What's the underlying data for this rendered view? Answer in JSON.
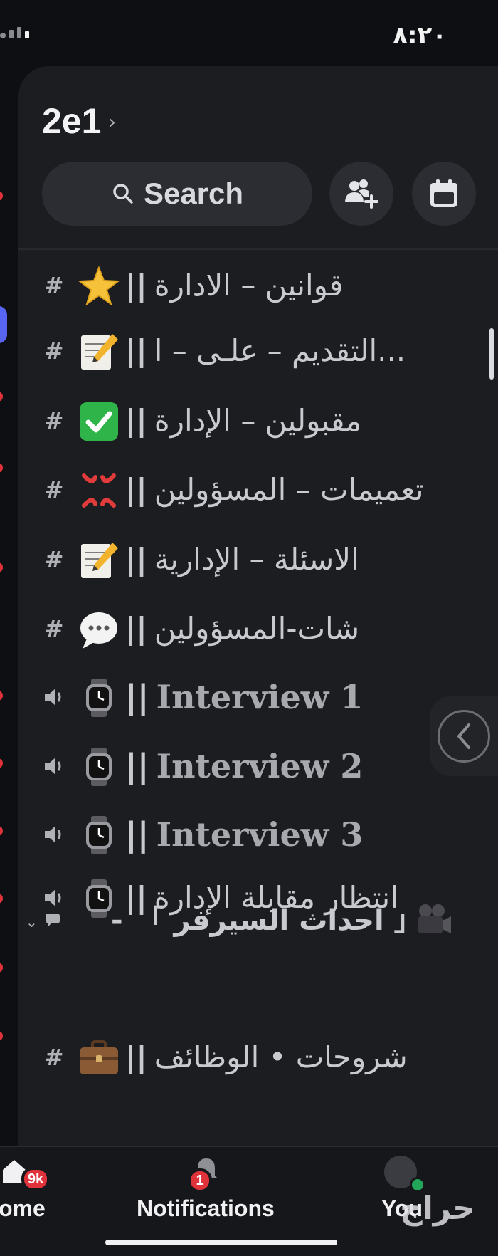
{
  "status_bar": {
    "time": "٨:٢٠"
  },
  "server": {
    "name": "2e1",
    "chevron": "›"
  },
  "search": {
    "label": "Search"
  },
  "channels": [
    {
      "type": "text",
      "emoji": "star",
      "sep": "||",
      "name": "قوانين – الادارة",
      "latin": false
    },
    {
      "type": "text",
      "emoji": "memo",
      "sep": "||",
      "name": "التقديم – علـى – ا...",
      "latin": false
    },
    {
      "type": "text-locked",
      "emoji": "check-mark",
      "sep": "||",
      "name": "مقبولين – الإدارة",
      "latin": false
    },
    {
      "type": "text-locked",
      "emoji": "anger",
      "sep": "||",
      "name": "تعميمات – المسؤولين",
      "latin": false
    },
    {
      "type": "text-locked",
      "emoji": "memo",
      "sep": "||",
      "name": "الاسئلة – الإدارية",
      "latin": false
    },
    {
      "type": "text-locked",
      "emoji": "speech-bubble",
      "sep": "||",
      "name": "شات-المسؤولين",
      "latin": false
    },
    {
      "type": "voice-locked",
      "emoji": "watch",
      "sep": "||",
      "name": "Interview 1",
      "latin": true
    },
    {
      "type": "voice-locked",
      "emoji": "watch",
      "sep": "||",
      "name": "Interview 2",
      "latin": true
    },
    {
      "type": "voice-locked",
      "emoji": "watch",
      "sep": "||",
      "name": "Interview 3",
      "latin": true
    },
    {
      "type": "voice-locked",
      "emoji": "watch",
      "sep": "||",
      "name": "انتظار مقابلة الإدارة",
      "latin": false
    }
  ],
  "category": {
    "chevron": "⌄",
    "name": "「 احداث السيرفر 」",
    "dash": "-",
    "emoji": "movie-camera"
  },
  "last_channel": {
    "type": "text",
    "emoji": "briefcase",
    "sep": "||",
    "name": "شروحات • الوظائف"
  },
  "nav": {
    "home": {
      "label": "ome",
      "badge": "9k"
    },
    "notifications": {
      "label": "Notifications",
      "badge": "1"
    },
    "you": {
      "label": "You"
    }
  },
  "watermark": "حراج",
  "colors": {
    "panel": "#1c1d21",
    "pill": "#2b2d32",
    "badge": "#e0323a",
    "online": "#23a55a"
  }
}
